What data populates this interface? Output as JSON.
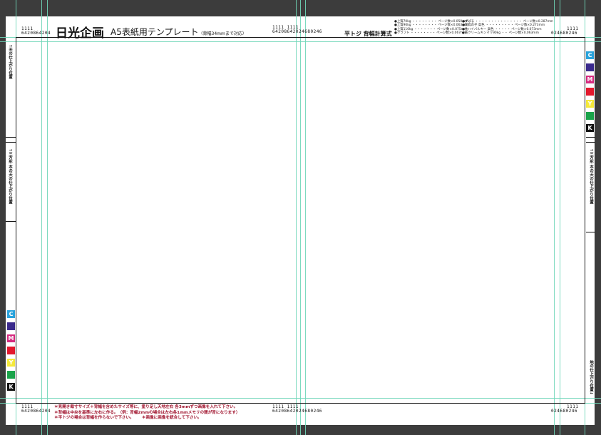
{
  "header": {
    "brand": "日光企画",
    "title": "A5表紙用テンプレート",
    "title_note": "（背幅34mmまで対応）",
    "scale_top": "1111",
    "scale_left_digits": "6420864204",
    "scale_center_digits": "6420864202468",
    "scale_center_tail": "0246",
    "scale_right_digits": "02468",
    "scale_right_tail": "0246",
    "spine_calc": "平トジ 背幅計算式"
  },
  "paper_list": {
    "col1": [
      "●上質70kg ・・・・・・・・ ページ数×0.050mm",
      "●上質90kg ・・・・・・・・ ページ数×0.063mm",
      "●上質110kg ・・・・・・・ ページ数×0.075mm",
      "●クラフト ・・・・・・・・ ページ数×0.067mm"
    ],
    "col2": [
      "●ずばる ・・・・・・・・・・・・・・・ ページ数×0.287mm",
      "●新鳥の子 高色 ・・・・・・・・・ ページ数×0.273mm",
      "●色ハイバルキー 高色 ・・・・・ ページ数×0.073mm",
      "●表クリームキンマリ90kg ・・ ページ数×0.063mm"
    ]
  },
  "side_labels": {
    "left_top": "↑天の仕上がり位置",
    "left_mid": "↑三方形 本の天の仕上がり位置",
    "right_mid": "↑三方形 本の天の仕上がり位置",
    "right_bottom": "地の仕上がり位置↓"
  },
  "swatches": [
    {
      "label": "C",
      "color": "#29a3dc",
      "text_color": "#ffffff"
    },
    {
      "label": "",
      "color": "#3a2a8c",
      "text_color": "#ffffff"
    },
    {
      "label": "M",
      "color": "#d62a7f",
      "text_color": "#ffffff"
    },
    {
      "label": "",
      "color": "#e3182d",
      "text_color": "#ffffff"
    },
    {
      "label": "Y",
      "color": "#f5e93a",
      "text_color": "#ffffff"
    },
    {
      "label": "",
      "color": "#1aa34a",
      "text_color": "#ffffff"
    },
    {
      "label": "K",
      "color": "#111111",
      "text_color": "#ffffff"
    }
  ],
  "notes": [
    "＊見開き裁寸サイズ＋背幅を含めたサイズ等に、塗り足し天地左右 各3mmずつ画像を入れて下さい。",
    "＊背幅は中央を基準に左右に作る。（例：背幅2mmの場合は左右各1mmメモリの間が背になります）",
    "＊平トジの場合は背幅を作らないで下さい。　　＊画像に画像を統合して下さい。"
  ],
  "scale_bottom": {
    "top": "1111",
    "left_digits": "6420864204",
    "center_digits": "6420864202468",
    "center_tail": "0246",
    "right_digits": "02468",
    "right_tail": "0246"
  },
  "colors": {
    "guide": "#6fd6b8",
    "background": "#3c3c3c",
    "note_red": "#a0142e"
  }
}
